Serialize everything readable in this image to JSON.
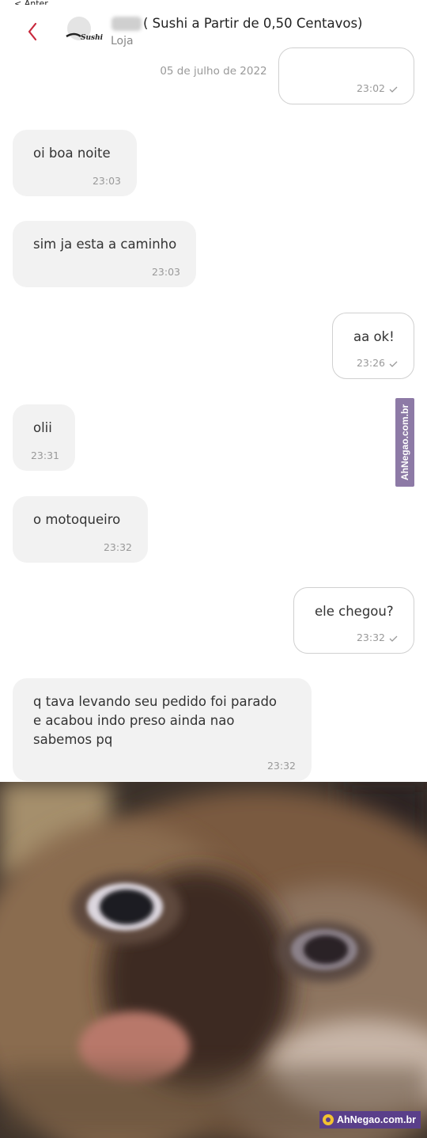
{
  "header": {
    "status_fragment": "< Anter",
    "title": "( Sushi a Partir de  0,50 Centavos)",
    "subtitle": "Loja",
    "avatar_text": "Sushi"
  },
  "date_separator": "05 de julho de 2022",
  "messages": [
    {
      "direction": "out",
      "text": "",
      "time": "23:02"
    },
    {
      "direction": "in",
      "text": "oi boa noite",
      "time": "23:03"
    },
    {
      "direction": "in",
      "text": "sim ja esta a caminho",
      "time": "23:03"
    },
    {
      "direction": "out",
      "text": "aa ok!",
      "time": "23:26"
    },
    {
      "direction": "in",
      "text": "olii",
      "time": "23:31"
    },
    {
      "direction": "in",
      "text": "o motoqueiro",
      "time": "23:32"
    },
    {
      "direction": "out",
      "text": "ele chegou?",
      "time": "23:32"
    },
    {
      "direction": "in",
      "text": "q tava levando seu pedido foi parado e acabou indo preso ainda nao sabemos pq",
      "time": "23:32"
    }
  ],
  "watermarks": {
    "side": "AhNegao.com.br",
    "bottom": "AhNegao.com.br"
  },
  "colors": {
    "accent": "#c8283c",
    "incoming_bubble": "#f2f2f2",
    "outgoing_border": "#d0d0d0",
    "watermark_side": "#8d7aa6",
    "watermark_bottom": "#5a3f8a"
  },
  "icons": {
    "back": "chevron-left-icon",
    "read_receipt": "check-icon"
  }
}
